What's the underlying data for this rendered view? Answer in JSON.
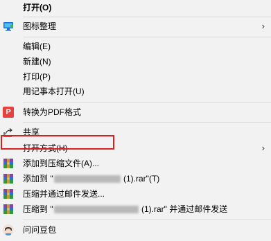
{
  "menu": {
    "open": "打开(O)",
    "icon_organize": "图标整理",
    "edit": "编辑(E)",
    "new": "新建(N)",
    "print": "打印(P)",
    "notepad": "用记事本打开(U)",
    "to_pdf": "转换为PDF格式",
    "pdf_icon_text": "P",
    "share": "共享",
    "open_with": "打开方式(H)",
    "add_archive": "添加到压缩文件(A)...",
    "add_to_prefix": "添加到 \"",
    "add_to_suffix": " (1).rar\"(T)",
    "compress_email": "压缩并通过邮件发送...",
    "compress_to_prefix": "压缩到 \"",
    "compress_to_suffix": " (1).rar\" 并通过邮件发送",
    "wenwen": "问问豆包"
  },
  "icons": {
    "organize": "monitor-icon",
    "pdf": "pdf-convert-icon",
    "share": "share-icon",
    "winrar": "winrar-icon",
    "doubao": "doubao-avatar-icon",
    "submenu": "chevron-right-icon"
  },
  "colors": {
    "background": "#f2f2f2",
    "highlight_border": "#d9201f",
    "separator": "#d9d9d9"
  }
}
